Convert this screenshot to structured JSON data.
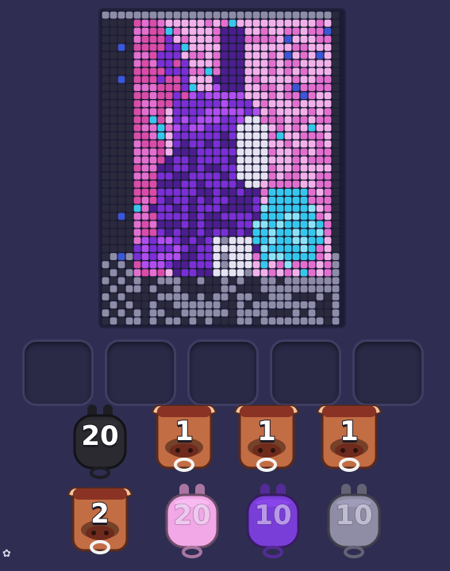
{
  "board": {
    "columns": 30,
    "rows": 39,
    "palette": {
      "frame_dark": "#2b2a3d",
      "frame_gray": "#8e8da7",
      "pink_light": "#f3b1ea",
      "pink_mid": "#e36fcf",
      "pink_hot": "#d94ca8",
      "purple": "#7a2fd6",
      "purple_dark": "#4b1d8e",
      "violet": "#b04ef0",
      "cyan": "#35c8ec",
      "cyan_light": "#8be4f6",
      "white": "#e6e3f2",
      "gray": "#8d8ba6",
      "blue": "#3b56d6"
    }
  },
  "slots": {
    "count": 5
  },
  "pieces": [
    {
      "name": "piece-black-20",
      "kind": "bunny",
      "color": "#2a2a30",
      "label": "20",
      "faded": false
    },
    {
      "name": "piece-bull-1-a",
      "kind": "bull",
      "color": "#c36d45",
      "label": "1",
      "faded": false
    },
    {
      "name": "piece-bull-1-b",
      "kind": "bull",
      "color": "#c36d45",
      "label": "1",
      "faded": false
    },
    {
      "name": "piece-bull-1-c",
      "kind": "bull",
      "color": "#c36d45",
      "label": "1",
      "faded": false
    },
    {
      "name": "piece-bull-2",
      "kind": "bull",
      "color": "#c36d45",
      "label": "2",
      "faded": false
    },
    {
      "name": "piece-pink-20",
      "kind": "bunny",
      "color": "#f2a8e6",
      "label": "20",
      "faded": true
    },
    {
      "name": "piece-purple-10",
      "kind": "bunny",
      "color": "#7a3ed8",
      "label": "10",
      "faded": true
    },
    {
      "name": "piece-gray-10",
      "kind": "bunny",
      "color": "#8f8da6",
      "label": "10",
      "faded": true
    }
  ],
  "icons": {
    "corner": "flower-icon"
  }
}
